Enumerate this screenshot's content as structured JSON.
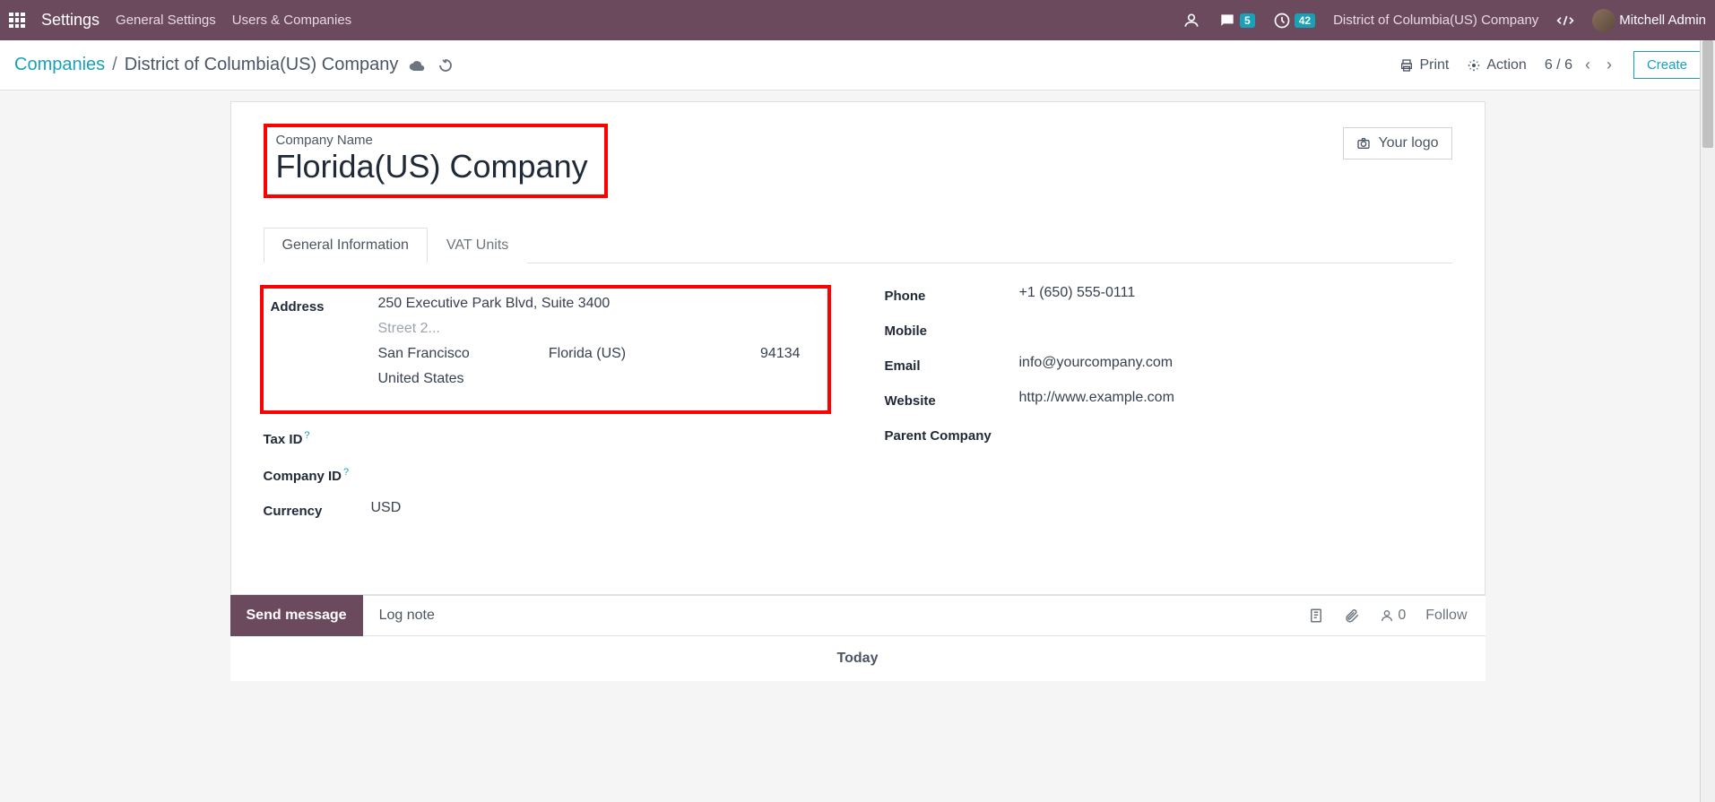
{
  "navbar": {
    "brand": "Settings",
    "links": [
      "General Settings",
      "Users & Companies"
    ],
    "message_badge": "5",
    "activity_badge": "42",
    "company": "District of Columbia(US) Company",
    "user": "Mitchell Admin"
  },
  "controlbar": {
    "breadcrumb_root": "Companies",
    "breadcrumb_current": "District of Columbia(US) Company",
    "print": "Print",
    "action": "Action",
    "pager": "6 / 6",
    "create": "Create"
  },
  "form": {
    "title_label": "Company Name",
    "title_value": "Florida(US) Company",
    "logo_label": "Your logo",
    "tabs": {
      "general": "General Information",
      "vat": "VAT Units"
    },
    "left": {
      "address_label": "Address",
      "street": "250 Executive Park Blvd, Suite 3400",
      "street2_placeholder": "Street 2...",
      "city": "San Francisco",
      "state": "Florida (US)",
      "zip": "94134",
      "country": "United States",
      "taxid_label": "Tax ID",
      "companyid_label": "Company ID",
      "currency_label": "Currency",
      "currency_value": "USD"
    },
    "right": {
      "phone_label": "Phone",
      "phone_value": "+1 (650) 555-0111",
      "mobile_label": "Mobile",
      "email_label": "Email",
      "email_value": "info@yourcompany.com",
      "website_label": "Website",
      "website_value": "http://www.example.com",
      "parent_label": "Parent Company"
    }
  },
  "chatter": {
    "send": "Send message",
    "lognote": "Log note",
    "followers": "0",
    "follow": "Follow",
    "today": "Today"
  }
}
